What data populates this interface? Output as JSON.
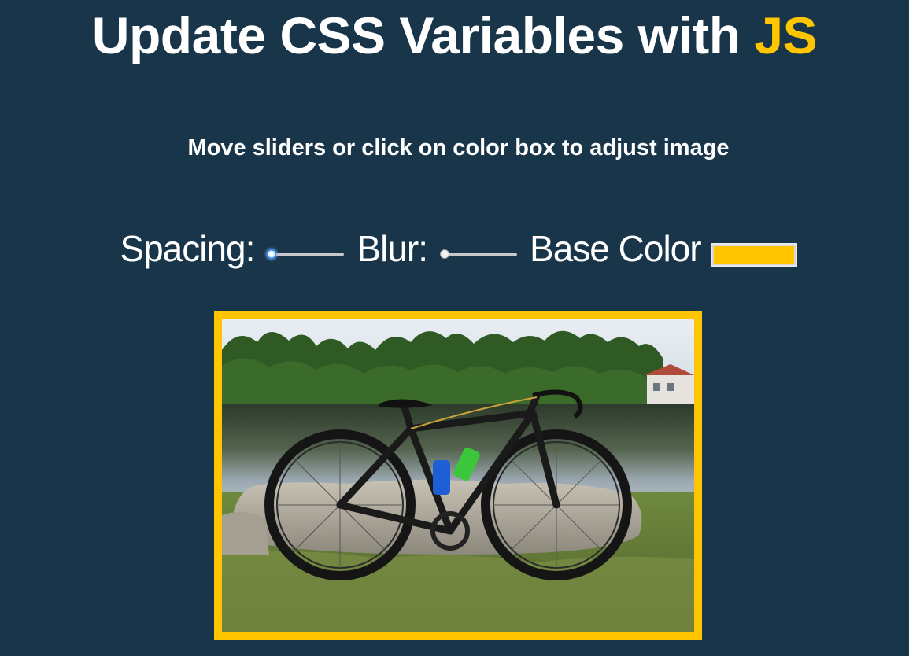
{
  "title": {
    "text_main": "Update CSS Variables with ",
    "text_highlight": "JS"
  },
  "subtitle": "Move sliders or click on color box to adjust image",
  "controls": {
    "spacing": {
      "label": "Spacing:",
      "value_fraction": 0.0
    },
    "blur": {
      "label": "Blur:",
      "value_fraction": 0.0
    },
    "base_color": {
      "label": "Base Color",
      "value": "#ffc600"
    }
  },
  "colors": {
    "background": "#193549",
    "accent": "#ffc600",
    "text": "#ffffff"
  },
  "image": {
    "description_icon": "photo-bicycle-by-lake"
  }
}
